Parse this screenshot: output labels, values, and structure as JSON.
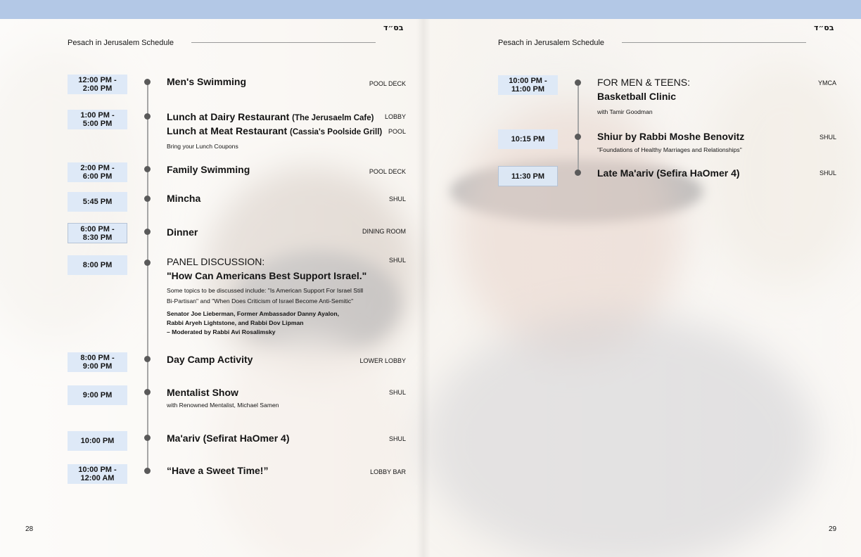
{
  "header": {
    "schedule_title": "Pesach in Jerusalem Schedule",
    "bsd": "בס״ד"
  },
  "left_page": {
    "page_number": "28",
    "events": [
      {
        "time": [
          "12:00 PM -",
          "2:00 PM"
        ],
        "title": "Men's Swimming",
        "location": "POOL DECK"
      },
      {
        "time": [
          "1:00 PM -",
          "5:00 PM"
        ],
        "title": "Lunch at Dairy Restaurant",
        "title_sub": "(The Jerusaelm Cafe)",
        "location": "LOBBY",
        "title2": "Lunch at Meat Restaurant",
        "title2_sub": "(Cassia's Poolside Grill)",
        "location2": "POOL",
        "note": "Bring your Lunch Coupons"
      },
      {
        "time": [
          "2:00 PM -",
          "6:00 PM"
        ],
        "title": "Family Swimming",
        "location": "POOL DECK"
      },
      {
        "time": [
          "5:45 PM"
        ],
        "title": "Mincha",
        "location": "SHUL"
      },
      {
        "time": [
          "6:00 PM -",
          "8:30 PM"
        ],
        "title": "Dinner",
        "location": "DINING ROOM"
      },
      {
        "time": [
          "8:00 PM"
        ],
        "title": "PANEL DISCUSSION:",
        "title2": "\"How Can Americans Best Support Israel.\"",
        "location": "SHUL",
        "notes": [
          "Some topics to be discussed include: \"Is American Support For Israel Still",
          "Bi-Partisan\" and \"When Does Criticism of Israel Become Anti-Semitic\""
        ],
        "speakers": [
          "Senator Joe Lieberman, Former Ambassador Danny Ayalon,",
          "Rabbi Aryeh Lightstone, and Rabbi Dov Lipman",
          "– Moderated by Rabbi Avi Rosalimsky"
        ]
      },
      {
        "time": [
          "8:00 PM -",
          "9:00 PM"
        ],
        "title": "Day Camp Activity",
        "location": "LOWER LOBBY"
      },
      {
        "time": [
          "9:00 PM"
        ],
        "title": "Mentalist Show",
        "location": "SHUL",
        "note": "with Renowned Mentalist, Michael Samen"
      },
      {
        "time": [
          "10:00 PM"
        ],
        "title": "Ma'ariv (Sefirat HaOmer 4)",
        "location": "SHUL"
      },
      {
        "time": [
          "10:00 PM -",
          "12:00 AM"
        ],
        "title": "“Have a Sweet Time!”",
        "location": "LOBBY BAR"
      }
    ]
  },
  "right_page": {
    "page_number": "29",
    "events": [
      {
        "time": [
          "10:00 PM -",
          "11:00 PM"
        ],
        "title": "FOR MEN & TEENS:",
        "title2": "Basketball Clinic",
        "location": "YMCA",
        "note": "with Tamir Goodman"
      },
      {
        "time": [
          "10:15 PM"
        ],
        "title": "Shiur by Rabbi Moshe Benovitz",
        "location": "SHUL",
        "note": "\"Foundations of Healthy Marriages and Relationships\""
      },
      {
        "time": [
          "11:30 PM"
        ],
        "title": "Late Ma'ariv (Sefira HaOmer 4)",
        "location": "SHUL"
      }
    ]
  }
}
